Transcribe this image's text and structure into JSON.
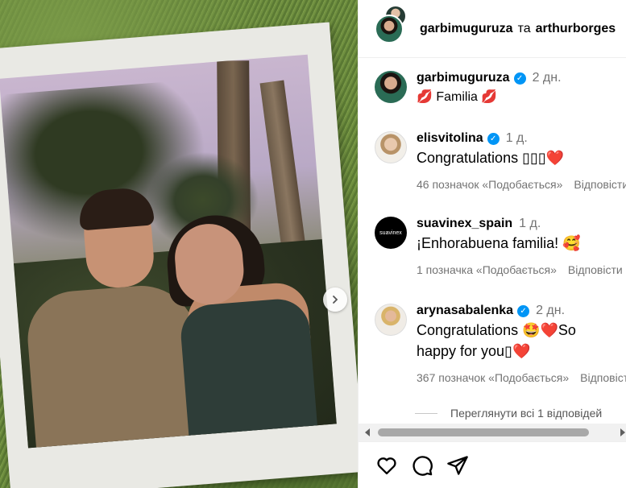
{
  "header": {
    "user1": "garbimuguruza",
    "conjunction": "та",
    "user2": "arthurborges"
  },
  "caption": {
    "username": "garbimuguruza",
    "time": "2 дн.",
    "text": "Familia",
    "emoji_left": "💋",
    "emoji_right": "💋"
  },
  "comments": [
    {
      "username": "elisvitolina",
      "verified": true,
      "time": "1 д.",
      "text": "Congratulations ",
      "text_boxes": "▯▯▯",
      "emoji": "❤️",
      "likes": "46 позначок «Подобається»",
      "reply": "Відповісти"
    },
    {
      "username": "suavinex_spain",
      "verified": false,
      "time": "1 д.",
      "text": "¡Enhorabuena familia! ",
      "emoji": "🥰",
      "likes": "1 позначка «Подобається»",
      "reply": "Відповісти",
      "avatar_text": "suavinex"
    },
    {
      "username": "arynasabalenka",
      "verified": true,
      "time": "2 дн.",
      "text_a": "Congratulations ",
      "emoji_a": "🤩❤️",
      "text_b": "So",
      "text_c": "happy for you",
      "text_boxes": "▯",
      "emoji_c": "❤️",
      "likes": "367 позначок «Подобається»",
      "reply": "Відповісти"
    }
  ],
  "view_replies": "Переглянути всі 1 відповідей",
  "icons": {
    "carousel_next": "chevron-right-icon",
    "like": "heart-icon",
    "comment": "comment-icon",
    "share": "share-icon",
    "verified": "verified-badge-icon"
  },
  "colors": {
    "verified": "#0095f6",
    "muted_text": "#737373",
    "heart": "#e0182d"
  }
}
